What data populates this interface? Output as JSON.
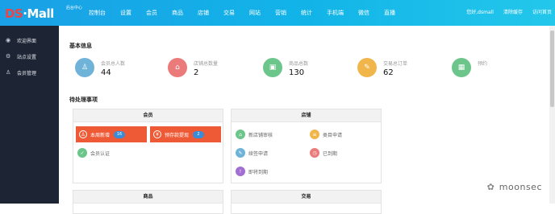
{
  "header": {
    "logo_brand": "DS",
    "logo_sep": "·",
    "logo_name": "Mall",
    "logo_sub": "后台中心",
    "nav": [
      "控制台",
      "设置",
      "会员",
      "商品",
      "店铺",
      "交易",
      "网站",
      "营销",
      "统计",
      "手机端",
      "微信",
      "直播"
    ],
    "right": [
      "您好,dsmall",
      "清除缓存",
      "访问首页"
    ]
  },
  "sidebar": {
    "items": [
      {
        "label": "欢迎界面",
        "icon": "eye-icon"
      },
      {
        "label": "站点设置",
        "icon": "gear-icon"
      },
      {
        "label": "会员管理",
        "icon": "user-icon"
      }
    ]
  },
  "basic": {
    "title": "基本信息",
    "stats": [
      {
        "label": "会员总人数",
        "value": "44",
        "color": "#6fb3d9",
        "icon": "user-icon"
      },
      {
        "label": "店铺总数量",
        "value": "2",
        "color": "#eb7a7a",
        "icon": "store-icon"
      },
      {
        "label": "商品总数",
        "value": "130",
        "color": "#6cc58a",
        "icon": "bag-icon"
      },
      {
        "label": "交易总订单",
        "value": "62",
        "color": "#f0b54b",
        "icon": "order-icon"
      },
      {
        "label": "预约",
        "value": "",
        "color": "#6cc58a",
        "icon": "gift-icon"
      }
    ]
  },
  "pending": {
    "title": "待处理事项",
    "panels": {
      "member": {
        "title": "会员",
        "this_week_label": "本周新增",
        "this_week_count": "16",
        "predeposit_label": "预存款提现",
        "predeposit_count": "2",
        "auth_label": "会员认证"
      },
      "store": {
        "title": "店铺",
        "items": [
          {
            "label": "新店铺审核",
            "color": "#6cc58a",
            "icon": "store-icon"
          },
          {
            "label": "类目申请",
            "color": "#f0b54b",
            "icon": "list-icon"
          },
          {
            "label": "续签申请",
            "color": "#6fb3d9",
            "icon": "pencil-icon"
          },
          {
            "label": "已到期",
            "color": "#eb7a7a",
            "icon": "clock-icon"
          },
          {
            "label": "即将到期",
            "color": "#a06fd1",
            "icon": "warning-icon"
          }
        ]
      },
      "goods": {
        "title": "商品"
      },
      "trade": {
        "title": "交易"
      }
    }
  },
  "watermark": {
    "text": "moonsec"
  },
  "colors": {
    "topbar": "#12b4e8",
    "sidebar": "#1d2433",
    "highlight": "#ef5a36",
    "badge": "#3b8cd8"
  }
}
